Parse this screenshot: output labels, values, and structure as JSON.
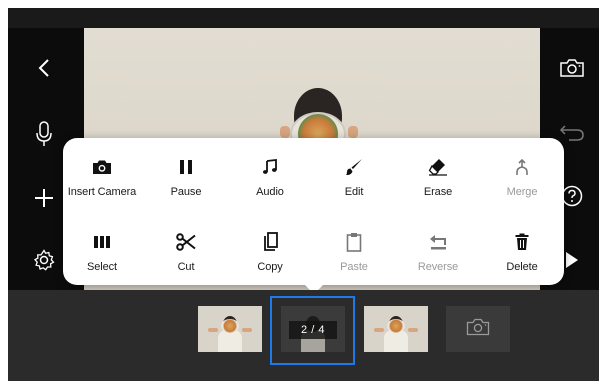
{
  "toolbar_left": {
    "back_icon": "chevron-left-icon",
    "mic_icon": "microphone-icon",
    "add_icon": "plus-icon",
    "settings_icon": "gear-icon"
  },
  "toolbar_right": {
    "camera_icon": "camera-icon",
    "undo_icon": "undo-icon",
    "help_icon": "help-icon",
    "play_icon": "play-icon"
  },
  "edit_menu": {
    "row1": [
      {
        "label": "Insert Camera",
        "icon": "camera-icon",
        "enabled": true
      },
      {
        "label": "Pause",
        "icon": "pause-icon",
        "enabled": true
      },
      {
        "label": "Audio",
        "icon": "music-note-icon",
        "enabled": true
      },
      {
        "label": "Edit",
        "icon": "brush-icon",
        "enabled": true
      },
      {
        "label": "Erase",
        "icon": "eraser-icon",
        "enabled": true
      },
      {
        "label": "Merge",
        "icon": "merge-icon",
        "enabled": false
      }
    ],
    "row2": [
      {
        "label": "Select",
        "icon": "select-bars-icon",
        "enabled": true
      },
      {
        "label": "Cut",
        "icon": "scissors-icon",
        "enabled": true
      },
      {
        "label": "Copy",
        "icon": "copy-icon",
        "enabled": true
      },
      {
        "label": "Paste",
        "icon": "clipboard-icon",
        "enabled": false
      },
      {
        "label": "Reverse",
        "icon": "reverse-icon",
        "enabled": false
      },
      {
        "label": "Delete",
        "icon": "trash-icon",
        "enabled": true
      }
    ]
  },
  "timeline": {
    "selected_clip_label": "2 / 4",
    "add_shot_icon": "camera-icon"
  },
  "colors": {
    "selection": "#1e7ae8",
    "menu_bg": "#ffffff",
    "disabled_text": "#9a9a9a"
  }
}
